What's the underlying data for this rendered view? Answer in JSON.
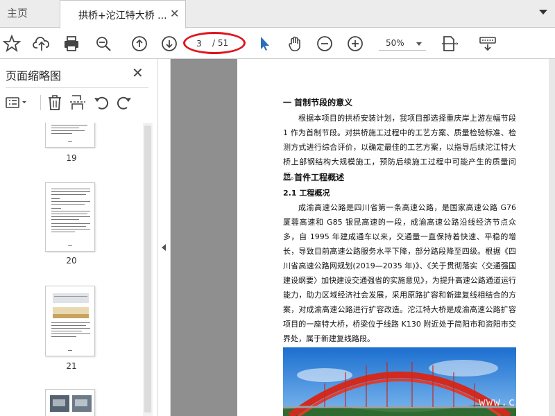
{
  "tabs": {
    "home_label": "主页",
    "active_title": "拱桥+沱江特大桥 ...",
    "close_glyph": "✕"
  },
  "toolbar": {
    "icons": [
      "star-icon",
      "upload-icon",
      "print-icon",
      "zoom-out-magnifier-icon",
      "prev-page-icon",
      "next-page-icon",
      "select-cursor-icon",
      "hand-icon",
      "zoom-minus-icon",
      "zoom-plus-icon",
      "fit-page-icon",
      "keyboard-icon"
    ],
    "current_page": "3",
    "total_pages": "/ 51",
    "zoom": "50%",
    "highlight_color": "#e0151c",
    "accent_color": "#2a6ebb"
  },
  "sidebar": {
    "title": "页面缩略图",
    "close_glyph": "✕",
    "thumbnails": [
      {
        "page": "19"
      },
      {
        "page": "20"
      },
      {
        "page": "21"
      },
      {
        "page": ""
      }
    ]
  },
  "document": {
    "heading1": "一 首制节段的意义",
    "para1": "根据本项目的拱桥安装计划，我项目部选择重庆岸上游左幅节段 1 作为首制节段。对拱桥施工过程中的工艺方案、质量检验标准、检测方式进行综合评价，以确定最佳的工艺方案，以指导后续沱江特大桥上部钢结构大规模施工，预防后续施工过程中可能产生的质量问题。",
    "heading2": "二 首件工程概述",
    "heading2_1": "2.1 工程概况",
    "para2": "成渝高速公路是四川省第一条高速公路，是国家高速公路 G76 厦蓉高速和 G85 银昆高速的一段，成渝高速公路沿线经济节点众多，自 1995 年建成通车以来，交通量一直保持着快速、平稳的增长，导致目前高速公路服务水平下降，部分路段降至四级。根据《四川省高速公路网规划(2019—2035 年)》、《关于贯彻落实〈交通强国建设纲要〉加快建设交通强省的实施意见》，为提升高速公路通道运行能力，助力区域经济社会发展，采用原路扩容和新建复线相结合的方案，对成渝高速公路进行扩容改造。沱江特大桥是成渝高速公路扩容项目的一座特大桥，桥梁位于线路 K130 附近处于简阳市和资阳市交界处，属于新建复线路段。",
    "watermark": "www.cnshu.com"
  }
}
